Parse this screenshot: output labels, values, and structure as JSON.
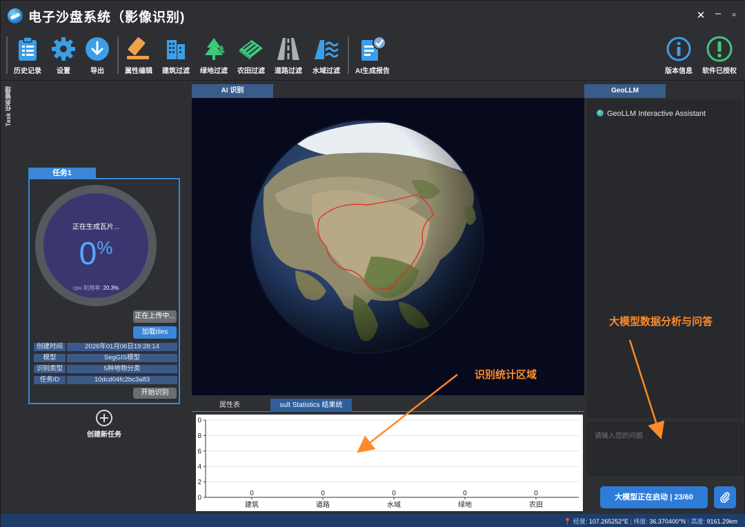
{
  "window": {
    "title": "电子沙盘系统（影像识别)",
    "controls": [
      "✕",
      "–",
      "▫"
    ]
  },
  "toolbar": {
    "history": "历史记录",
    "settings": "设置",
    "export": "导出",
    "attr_edit": "属性编辑",
    "building_filter": "建筑过滤",
    "green_filter": "绿地过滤",
    "farm_filter": "农田过滤",
    "road_filter": "道路过滤",
    "water_filter": "水域过滤",
    "ai_report": "AI生成报告",
    "version_info": "版本信息",
    "licensed": "软件已授权"
  },
  "sidebar": {
    "vertical_tab": "Task 任务管理"
  },
  "task": {
    "tab_label": "任务1",
    "status_text": "正在生成瓦片...",
    "progress_value": "0",
    "progress_unit": "%",
    "progress_fraction": 0.0,
    "cpu_label": "cpu 利用率:",
    "cpu_value": "20.3%",
    "upload_button": "正在上传中...",
    "load_tiles_button": "加载tiles",
    "info": [
      {
        "key": "创建时间",
        "value": "2026年01月06日19:28:14"
      },
      {
        "key": "模型",
        "value": "SegGIS模型"
      },
      {
        "key": "识别类型",
        "value": "5种地物分类"
      },
      {
        "key": "任务ID",
        "value": "10dcd04fc2bc3a83"
      }
    ],
    "start_button": "开始识别",
    "new_task": "创建新任务"
  },
  "center": {
    "ai_tab": "AI 识别",
    "bottom_tabs": [
      "属性表",
      "sult Statistics 结果统"
    ]
  },
  "chart_data": {
    "type": "bar",
    "categories": [
      "建筑",
      "道路",
      "水域",
      "绿地",
      "农田"
    ],
    "values": [
      0,
      0,
      0,
      0,
      0
    ],
    "y_ticks": [
      "0",
      "2",
      "4",
      "6",
      "8",
      "0"
    ],
    "ylim": [
      0,
      10
    ],
    "grid": true,
    "title": "",
    "xlabel": "",
    "ylabel": ""
  },
  "geollm": {
    "tab_label": "GeoLLM",
    "header": "GeoLLM Interactive Assistant",
    "input_placeholder": "请输入您的问题",
    "start_button": "大模型正在启动 | 23/60"
  },
  "annotations": {
    "llm_note": "大模型数据分析与问答",
    "stats_note": "识别统计区域"
  },
  "status": {
    "lon_label": "经度:",
    "lon_value": "107.265252°E",
    "lat_label": "纬度:",
    "lat_value": "36.370400°N",
    "alt_label": "高度:",
    "alt_value": "9161.29km"
  },
  "colors": {
    "accent": "#3a86d8",
    "annotation": "#ff8a2a",
    "status_bar": "#1f3d6c",
    "progress_text": "#5aa7ff"
  }
}
